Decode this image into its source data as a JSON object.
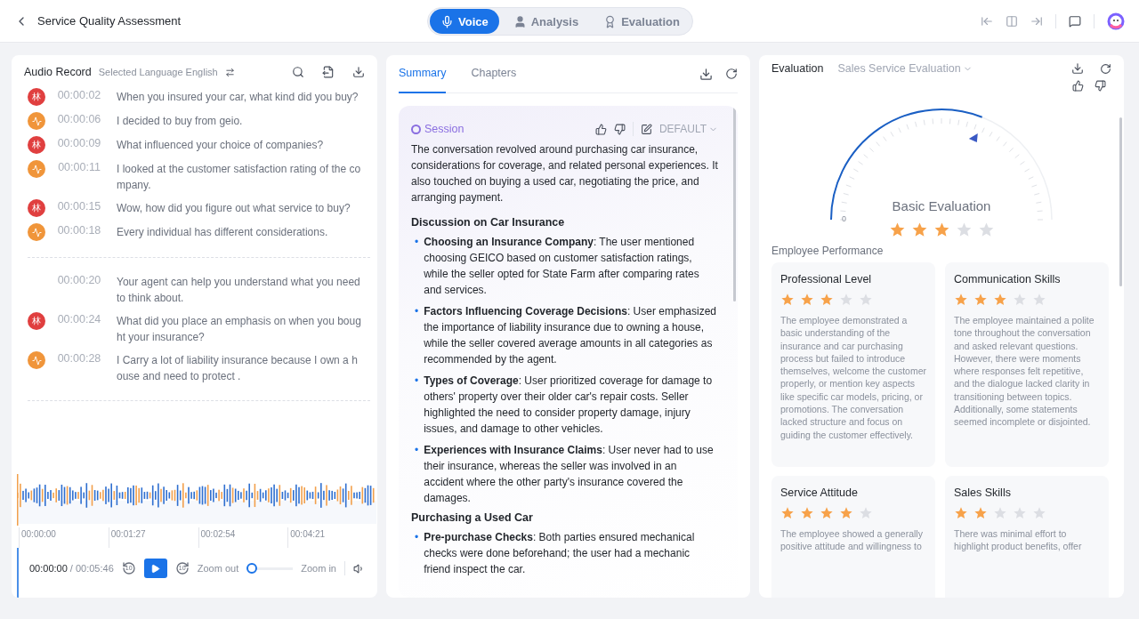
{
  "header": {
    "title": "Service Quality Assessment",
    "modes": [
      {
        "label": "Voice",
        "kind": "mic",
        "selected": true
      },
      {
        "label": "Analysis",
        "kind": "person",
        "selected": false
      },
      {
        "label": "Evaluation",
        "kind": "badge",
        "selected": false
      }
    ]
  },
  "audio_record": {
    "title": "Audio Record",
    "language": "Selected Language English",
    "groups": [
      [
        {
          "kind": "agent",
          "avatar": "林",
          "time": "00:00:02",
          "text": "When you insured your car, what kind did you buy?"
        },
        {
          "kind": "customer",
          "time": "00:00:06",
          "text": "I decided to buy from geio."
        },
        {
          "kind": "agent",
          "avatar": "林",
          "time": "00:00:09",
          "text": "What influenced your choice of companies?"
        },
        {
          "kind": "customer",
          "time": "00:00:11",
          "text": "I looked at the customer satisfaction rating of the company."
        },
        {
          "kind": "agent",
          "avatar": "林",
          "time": "00:00:15",
          "text": "Wow, how did you figure out what service to buy?"
        },
        {
          "kind": "customer",
          "time": "00:00:18",
          "text": "Every individual has different considerations."
        }
      ],
      [
        {
          "kind": "none",
          "time": "00:00:20",
          "text": "Your agent can help you understand what you need to think about."
        },
        {
          "kind": "agent",
          "avatar": "林",
          "time": "00:00:24",
          "text": "What did you place an emphasis on when you bought your insurance?"
        },
        {
          "kind": "customer",
          "time": "00:00:28",
          "text": "I Carry a lot of liability insurance because I own a house and need to protect ."
        }
      ]
    ],
    "timeline": [
      "00:00:00",
      "00:01:27",
      "00:02:54",
      "00:04:21"
    ],
    "player": {
      "current": "00:00:00",
      "total": "/ 00:05:46",
      "rewind_label": "10",
      "forward_label": "10",
      "zoom_out": "Zoom out",
      "zoom_in": "Zoom in",
      "zoom": {
        "level": 0
      }
    }
  },
  "summary": {
    "tabs": [
      {
        "label": "Summary",
        "selected": true
      },
      {
        "label": "Chapters",
        "selected": false
      }
    ],
    "session": {
      "label": "Session",
      "template": "DEFAULT",
      "intro": "The conversation revolved around purchasing car insurance, considerations for coverage, and related personal experiences. It also touched on buying a used car, negotiating the price, and arranging payment.",
      "sections": [
        {
          "heading": "Discussion on Car Insurance",
          "bullets": [
            {
              "marker": "•",
              "text": "**Choosing an Insurance Company**: The user mentioned choosing GEICO based on customer satisfaction ratings, while the seller opted for State Farm after comparing rates and services."
            },
            {
              "marker": "•",
              "text": "**Factors Influencing Coverage Decisions**: User emphasized the importance of liability insurance due to owning a house, while the seller covered average amounts in all categories as recommended by the agent."
            },
            {
              "marker": "•",
              "text": "**Types of Coverage**: User prioritized coverage for damage to others' property over their older car's repair costs. Seller highlighted the need to consider property damage, injury issues, and damage to other vehicles."
            },
            {
              "marker": "•",
              "text": "**Experiences with Insurance Claims**: User never had to use their insurance, whereas the seller was involved in an accident where the other party's insurance covered the damages."
            }
          ]
        },
        {
          "heading": "Purchasing a Used Car",
          "bullets": [
            {
              "marker": "•",
              "text": "**Pre-purchase Checks**: Both parties ensured mechanical checks were done beforehand; the user had a mechanic friend inspect the car."
            }
          ]
        }
      ]
    }
  },
  "evaluation": {
    "title": "Evaluation",
    "template": "Sales Service Evaluation",
    "gauge": {
      "label": "Basic Evaluation",
      "zero": "0",
      "level": 0.62,
      "stars": 3
    },
    "performance_title": "Employee Performance",
    "cards": [
      {
        "title": "Professional Level",
        "stars": 3,
        "text": "The employee demonstrated a basic understanding of the insurance and car purchasing process but failed to introduce themselves, welcome the customer properly, or mention key aspects like specific car models, pricing, or promotions. The conversation lacked structure and focus on guiding the customer effectively."
      },
      {
        "title": "Communication Skills",
        "stars": 3,
        "text": "The employee maintained a polite tone throughout the conversation and asked relevant questions. However, there were moments where responses felt repetitive, and the dialogue lacked clarity in transitioning between topics. Additionally, some statements seemed incomplete or disjointed."
      },
      {
        "title": "Service Attitude",
        "stars": 4,
        "text": "The employee showed a generally positive attitude and willingness to"
      },
      {
        "title": "Sales Skills",
        "stars": 2,
        "text": "There was minimal effort to highlight product benefits, offer"
      }
    ]
  }
}
